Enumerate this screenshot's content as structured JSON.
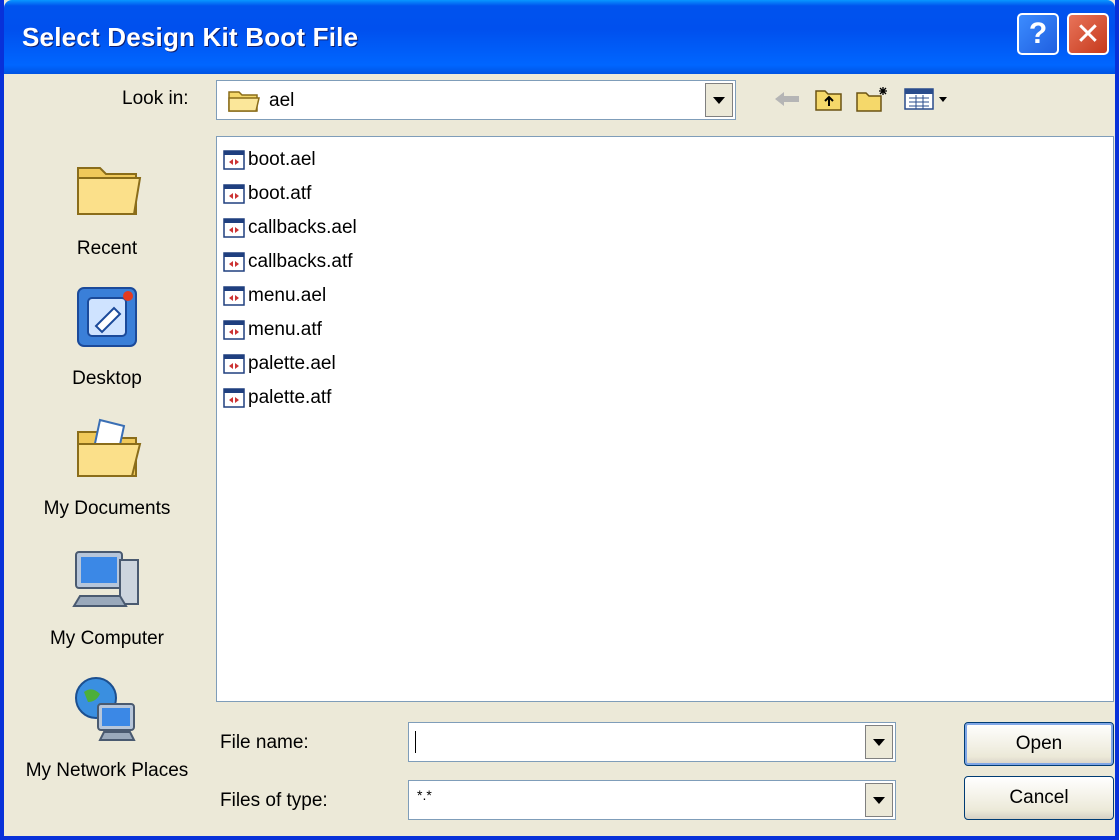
{
  "window": {
    "title": "Select Design Kit Boot File",
    "help_label": "?",
    "close_label": "✕"
  },
  "lookin": {
    "label": "Look in:",
    "value": "ael"
  },
  "places": [
    {
      "label": "Recent",
      "icon": "recent-folder-icon"
    },
    {
      "label": "Desktop",
      "icon": "desktop-icon"
    },
    {
      "label": "My Documents",
      "icon": "my-documents-icon"
    },
    {
      "label": "My Computer",
      "icon": "my-computer-icon"
    },
    {
      "label": "My Network Places",
      "icon": "network-places-icon"
    }
  ],
  "files": [
    "boot.ael",
    "boot.atf",
    "callbacks.ael",
    "callbacks.atf",
    "menu.ael",
    "menu.atf",
    "palette.ael",
    "palette.atf"
  ],
  "form": {
    "filename_label": "File name:",
    "filename_value": "",
    "filetype_label": "Files of type:",
    "filetype_value": "*.*",
    "open_label": "Open",
    "cancel_label": "Cancel"
  },
  "colors": {
    "titlebar": "#0054e3",
    "face": "#ece9d8",
    "folder": "#f5d86a"
  }
}
